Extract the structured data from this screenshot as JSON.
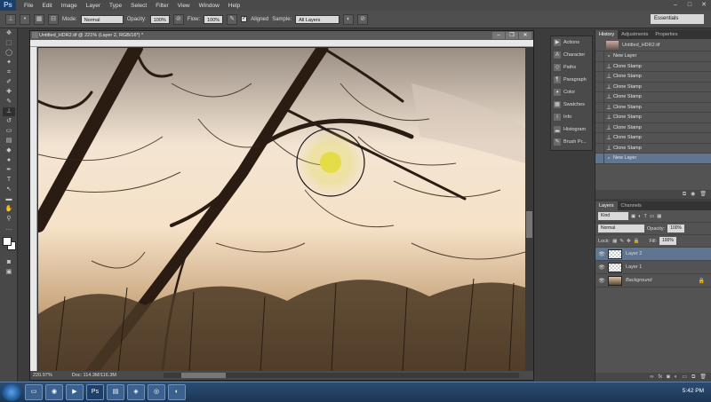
{
  "app": {
    "logo": "Ps"
  },
  "menu": [
    "File",
    "Edit",
    "Image",
    "Layer",
    "Type",
    "Select",
    "Filter",
    "View",
    "Window",
    "Help"
  ],
  "options": {
    "mode_label": "Mode:",
    "mode_value": "Normal",
    "opacity_label": "Opacity:",
    "opacity_value": "100%",
    "flow_label": "Flow:",
    "flow_value": "100%",
    "aligned_label": "Aligned",
    "sample_label": "Sample:",
    "sample_value": "All Layers",
    "workspace": "Essentials"
  },
  "document": {
    "title": "Untitled_HDR2.tif @ 221% (Layer 2, RGB/16*) *",
    "zoom": "220.97%",
    "doc_size": "Doc: 114.3M/116.3M"
  },
  "dock": [
    "Actions",
    "Character",
    "Paths",
    "Paragraph",
    "Color",
    "Swatches",
    "Info",
    "Histogram",
    "Brush Pr..."
  ],
  "history": {
    "tabs": [
      "History",
      "Adjustments",
      "Properties"
    ],
    "snapshot": "Untitled_HDR2.tif",
    "items": [
      "New Layer",
      "Clone Stamp",
      "Clone Stamp",
      "Clone Stamp",
      "Clone Stamp",
      "Clone Stamp",
      "Clone Stamp",
      "Clone Stamp",
      "Clone Stamp",
      "Clone Stamp",
      "New Layer"
    ]
  },
  "layers": {
    "tabs": [
      "Layers",
      "Channels"
    ],
    "filter": "Kind",
    "blend": "Normal",
    "opacity_label": "Opacity:",
    "opacity_value": "100%",
    "lock_label": "Lock:",
    "fill_label": "Fill:",
    "fill_value": "100%",
    "items": [
      "Layer 2",
      "Layer 1",
      "Background"
    ]
  },
  "taskbar": {
    "clock": "5:42 PM"
  }
}
